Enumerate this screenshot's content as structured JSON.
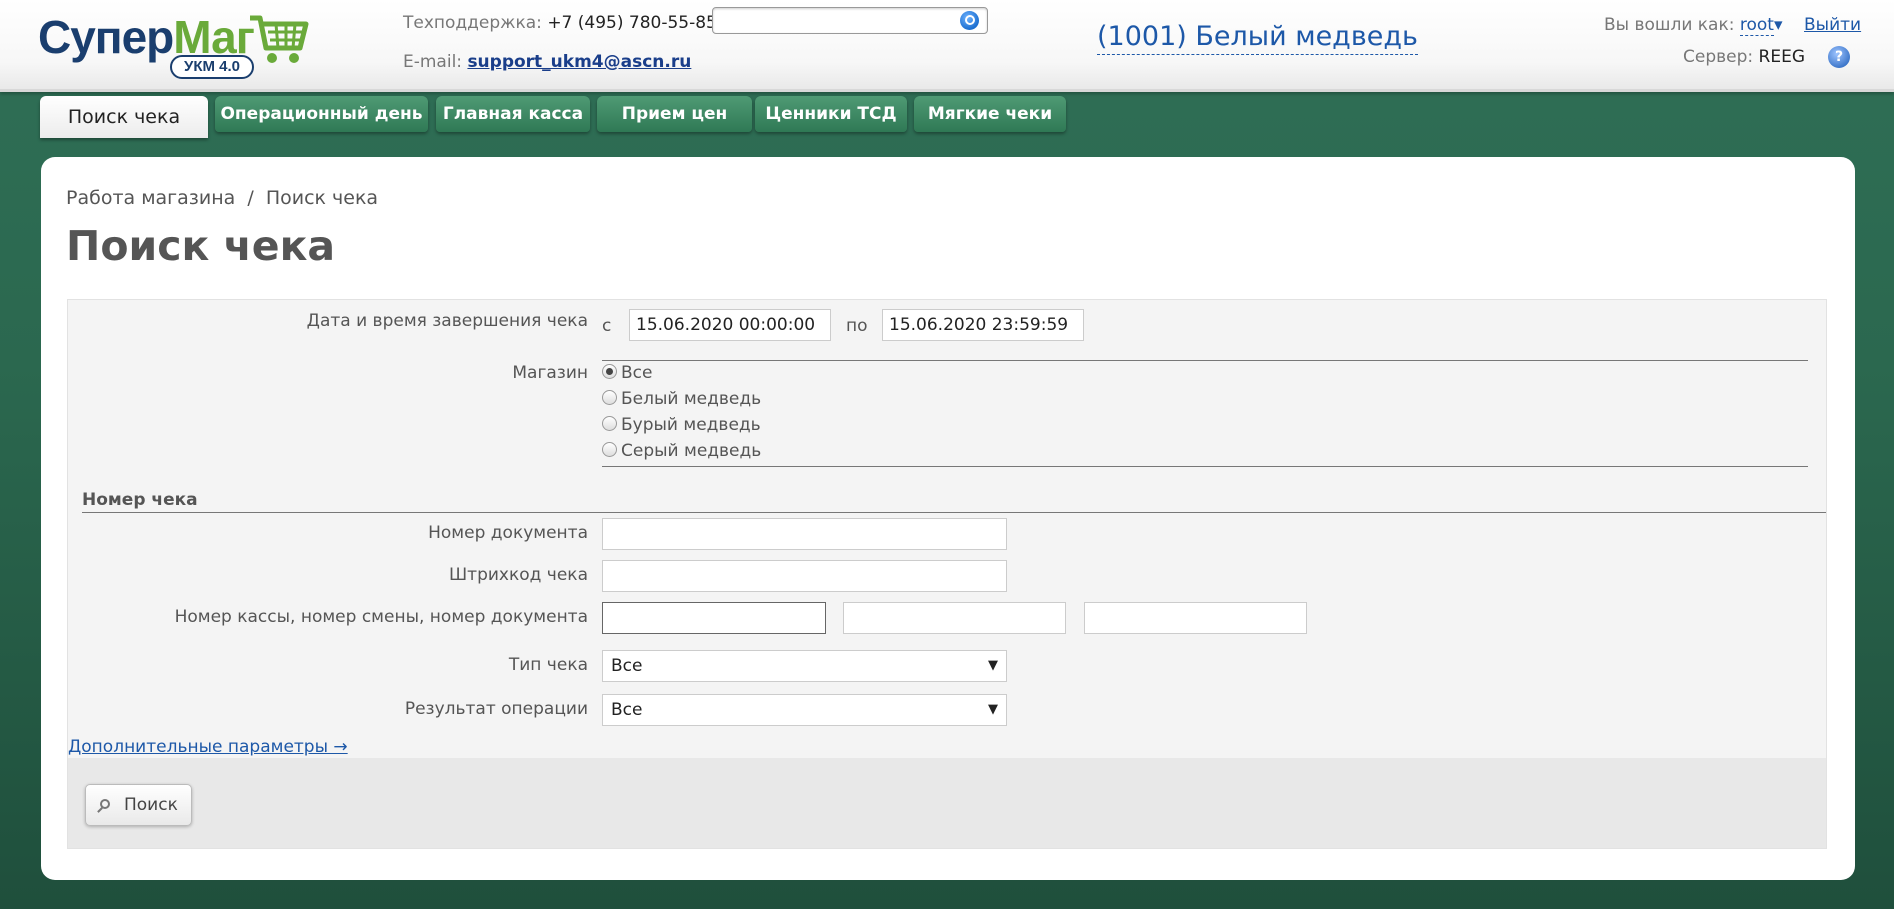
{
  "header": {
    "logo_main_a": "Супер",
    "logo_main_b": "Маг",
    "logo_badge": "УКМ 4.0",
    "support_label": "Техподдержка:",
    "support_phone": "+7 (495) 780-55-85",
    "email_label": "E-mail:",
    "email": "support_ukm4@ascn.ru",
    "search_value": "",
    "store_title": "(1001) Белый медведь",
    "login_label": "Вы вошли как:",
    "user": "root",
    "user_caret": "▾",
    "logout": "Выйти",
    "server_label": "Сервер:",
    "server": "REEG",
    "help": "?"
  },
  "tabs": [
    {
      "label": "Поиск чека",
      "active": true
    },
    {
      "label": "Операционный день"
    },
    {
      "label": "Главная касса"
    },
    {
      "label": "Прием цен"
    },
    {
      "label": "Ценники ТСД"
    },
    {
      "label": "Мягкие чеки"
    }
  ],
  "breadcrumb": {
    "parent": "Работа магазина",
    "separator": "/",
    "current": "Поиск чека"
  },
  "page_title": "Поиск чека",
  "form": {
    "datetime_label": "Дата и время завершения чека",
    "from_label": "с",
    "from_value": "15.06.2020 00:00:00",
    "to_label": "по",
    "to_value": "15.06.2020 23:59:59",
    "store_label": "Магазин",
    "stores": [
      {
        "label": "Все",
        "checked": true
      },
      {
        "label": "Белый медведь"
      },
      {
        "label": "Бурый медведь"
      },
      {
        "label": "Серый медведь"
      }
    ],
    "section_receipt": "Номер чека",
    "doc_number_label": "Номер документа",
    "doc_number_value": "",
    "barcode_label": "Штрихкод чека",
    "barcode_value": "",
    "register_label": "Номер кассы, номер смены, номер документа",
    "receipt_type_label": "Тип чека",
    "receipt_type_value": "Все",
    "result_label": "Результат операции",
    "result_value": "Все",
    "more_params": "Дополнительные параметры →",
    "search_button": "Поиск"
  }
}
